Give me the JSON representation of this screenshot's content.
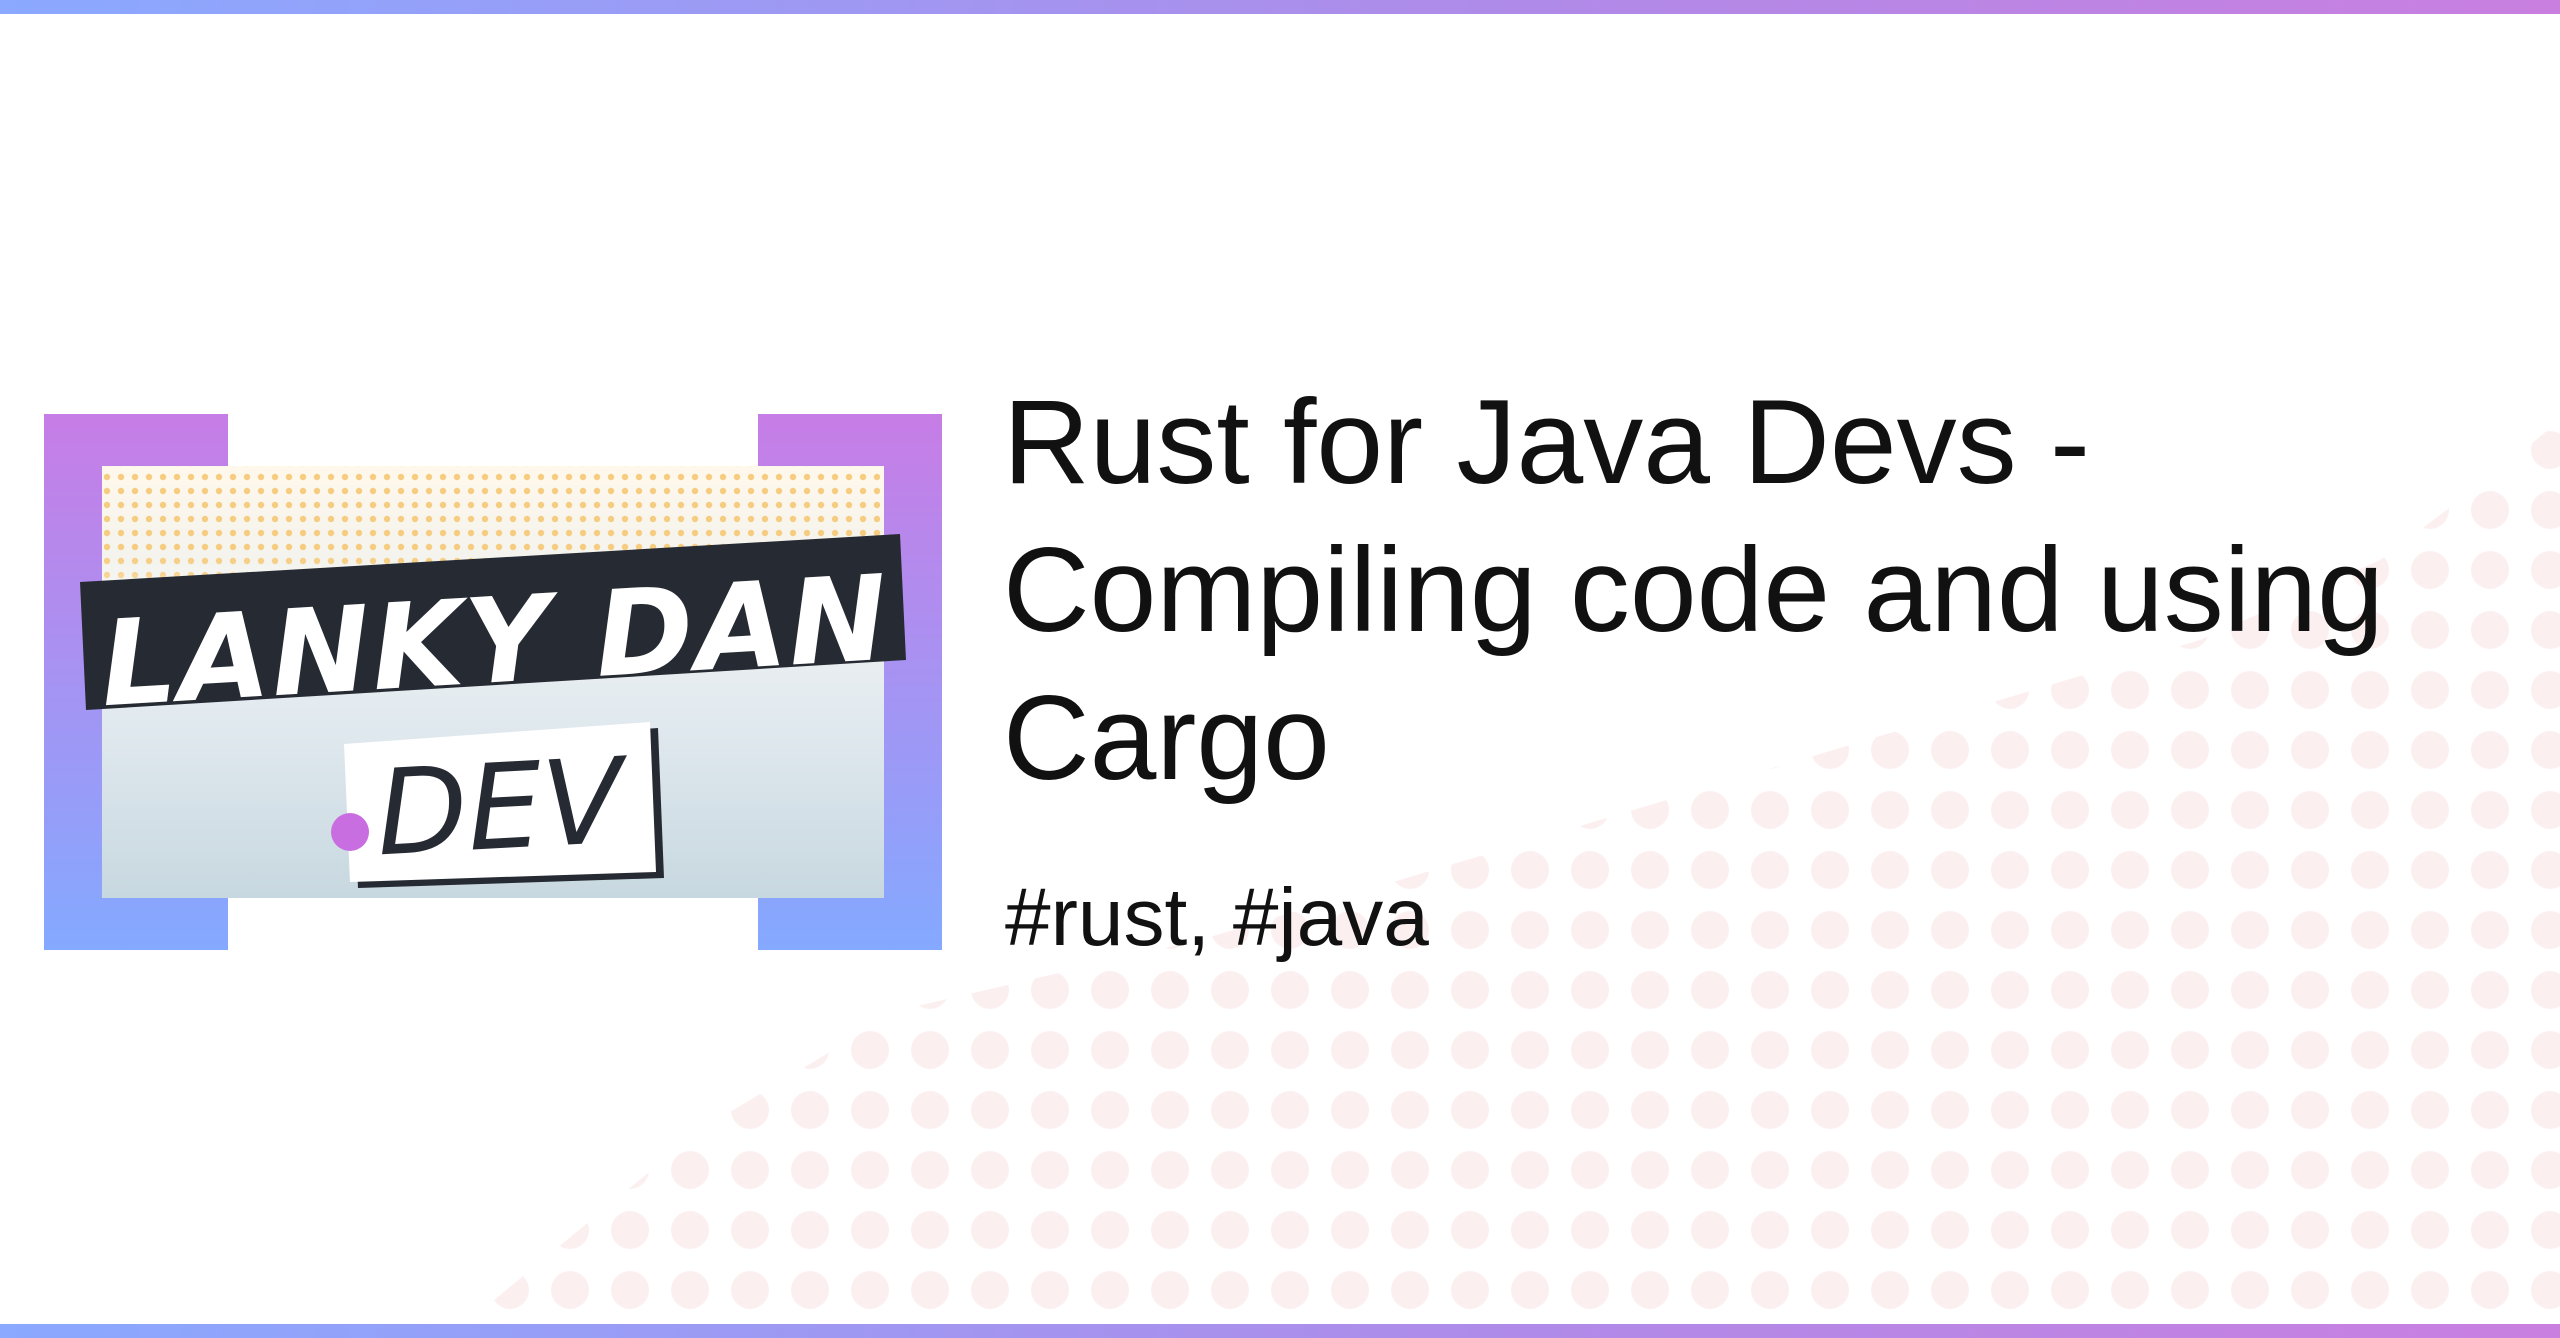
{
  "logo": {
    "line1": "LANKY DAN",
    "line2": "DEV"
  },
  "post": {
    "title": "Rust for Java Devs - Compiling code and using Cargo",
    "tags": "#rust, #java"
  },
  "colors": {
    "bracket_top": "#c77de6",
    "bracket_bottom": "#84a9ff",
    "banner": "#262a33",
    "accent_dot": "#c86ee0",
    "background_dots": "#fdf1f1"
  }
}
